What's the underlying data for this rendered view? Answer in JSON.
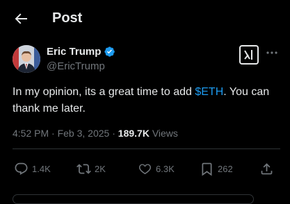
{
  "header": {
    "title": "Post"
  },
  "author": {
    "name": "Eric Trump",
    "handle": "@EricTrump"
  },
  "tweet": {
    "text_before": "In my opinion, its a great time to add ",
    "cashtag": "$ETH",
    "text_after": ". You can thank me later."
  },
  "meta": {
    "time": "4:52 PM",
    "dot1": "·",
    "date": "Feb 3, 2025",
    "dot2": "·",
    "views_count": "189.7K",
    "views_label": "Views"
  },
  "actions": {
    "replies": "1.4K",
    "reposts": "2K",
    "likes": "6.3K",
    "bookmarks": "262"
  },
  "colors": {
    "accent": "#1d9bf0",
    "text": "#e7e9ea",
    "muted": "#71767b",
    "background": "#000000"
  }
}
